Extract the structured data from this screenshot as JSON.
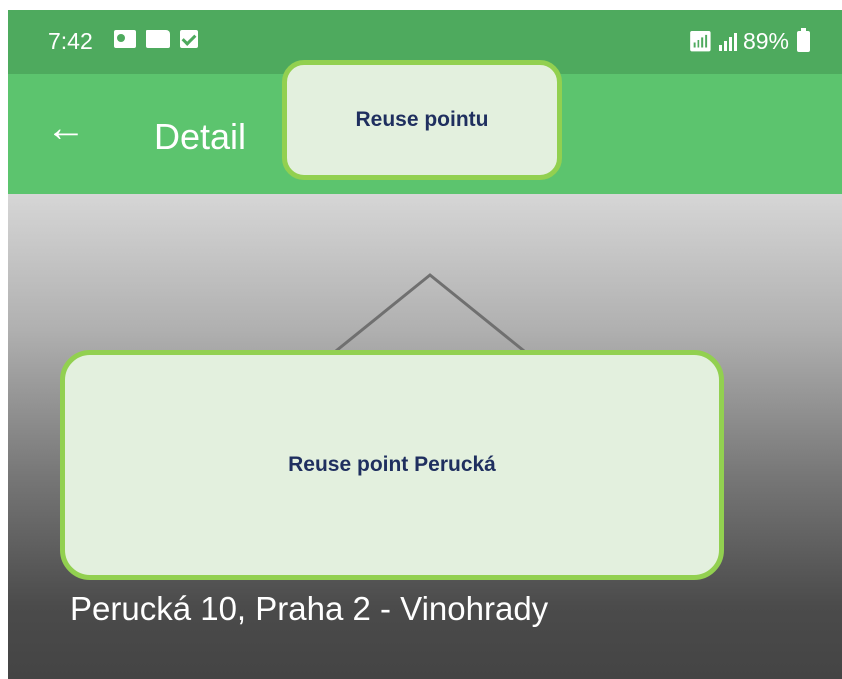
{
  "status_bar": {
    "time": "7:42",
    "battery": "89%",
    "icons": [
      "card-icon",
      "folder-icon",
      "checkbox-icon",
      "wifi-icon",
      "signal-icon",
      "battery-icon"
    ]
  },
  "app_bar": {
    "back_icon": "←",
    "title": "Detail"
  },
  "hero": {
    "address": "Perucká 10, Praha 2 - Vinohrady"
  },
  "callouts": {
    "top": "Reuse pointu",
    "middle": "Reuse point Perucká"
  },
  "colors": {
    "status_bar": "#4eaa5e",
    "app_bar": "#5cc46e",
    "callout_fill": "#e3f0de",
    "callout_border": "#92d050",
    "callout_text": "#1f2f5f"
  }
}
